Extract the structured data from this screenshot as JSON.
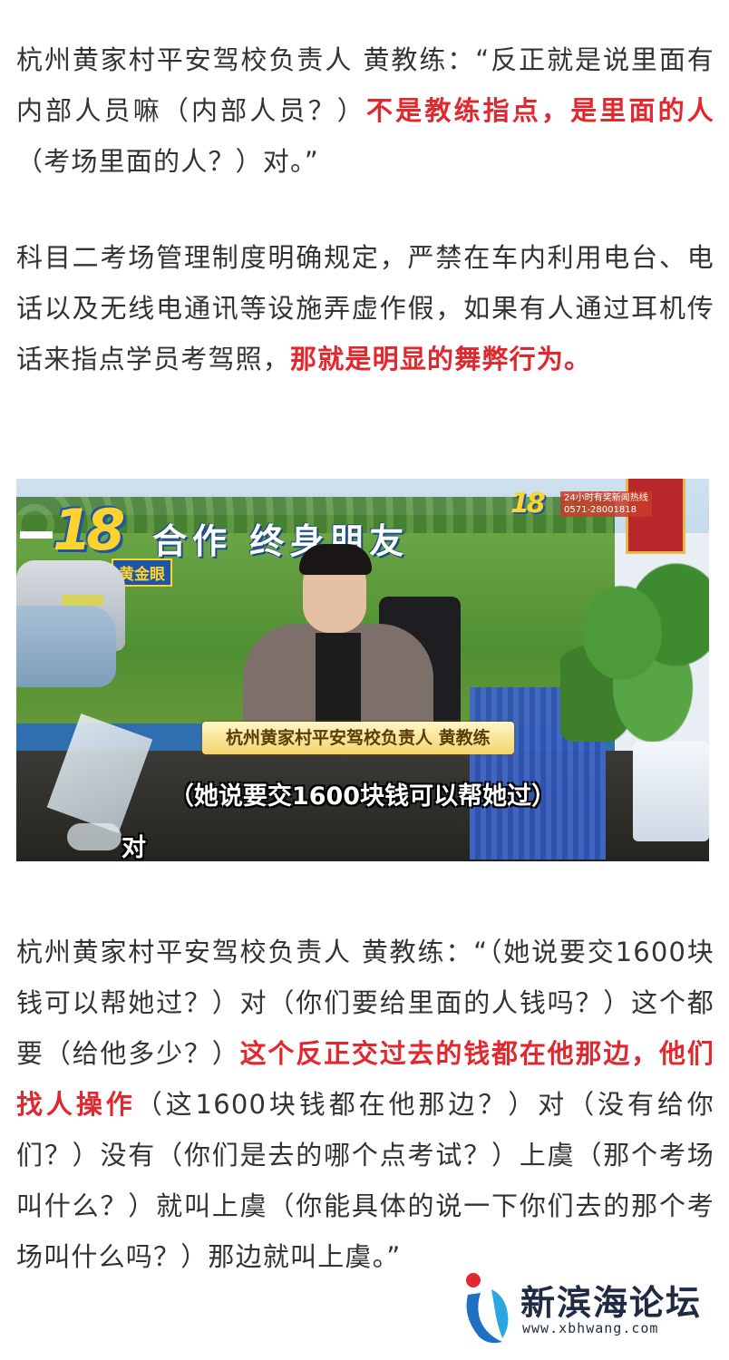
{
  "paragraph1": {
    "prefix": "杭州黄家村平安驾校负责人 黄教练：“反正就是说里面有内部人员嘛（内部人员？）",
    "highlight": "不是教练指点，是里面的人",
    "suffix": "（考场里面的人？）对。”"
  },
  "paragraph2": {
    "prefix": "科目二考场管理制度明确规定，严禁在车内利用电台、电话以及无线电通讯等设施弄虚作假，如果有人通过耳机传话来指点学员考驾照，",
    "highlight": "那就是明显的舞弊行为。"
  },
  "video_still": {
    "banner_text": "合作   终身朋友",
    "logo_main": "18",
    "logo_tag": "黄金眼",
    "logo_small": "18",
    "hotline_line1": "24小时有奖新闻热线",
    "hotline_line2": "0571-28001818",
    "name_caption": "杭州黄家村平安驾校负责人 黄教练",
    "subtitle_line1": "（她说要交1600块钱可以帮她过）",
    "subtitle_line2": "对"
  },
  "paragraph3": {
    "prefix": "杭州黄家村平安驾校负责人 黄教练：“（她说要交1600块钱可以帮她过？）对（你们要给里面的人钱吗？）这个都要（给他多少？）",
    "highlight": "这个反正交过去的钱都在他那边，他们找人操作",
    "suffix": "（这1600块钱都在他那边？）对（没有给你们？）没有（你们是去的哪个点考试？）上虞（那个考场叫什么？）就叫上虞（你能具体的说一下你们去的那个考场叫什么吗？）那边就叫上虞。”"
  },
  "watermark": {
    "name": "新滨海论坛",
    "url": "www.xbhwang.com"
  },
  "colors": {
    "highlight": "#e0282e",
    "text": "#333333",
    "watermark": "#1f2a44"
  }
}
